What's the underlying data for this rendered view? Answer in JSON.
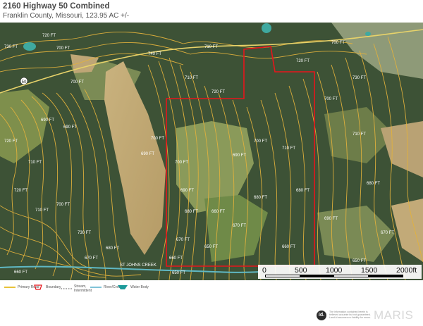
{
  "header": {
    "title": "2160 Highway 50 Combined",
    "subtitle": "Franklin County, Missouri, 123.95 AC +/-"
  },
  "map": {
    "road_marker": "50",
    "contour_labels": [
      "720 FT",
      "700 FT",
      "730 FT",
      "740 FT",
      "710 FT",
      "700 FT",
      "700 FT",
      "690 FT",
      "690 FT",
      "720 FT",
      "710 FT",
      "720 FT",
      "700 FT",
      "710 FT",
      "730 FT",
      "660 FT",
      "670 FT",
      "680 FT",
      "690 FT",
      "700 FT",
      "710 FT",
      "720 FT",
      "700 FT",
      "690 FT",
      "680 FT",
      "670 FT",
      "660 FT",
      "650 FT",
      "650 FT",
      "660 FT",
      "670 FT",
      "680 FT",
      "690 FT",
      "700 FT",
      "710 FT",
      "720 FT",
      "730 FT",
      "700 FT",
      "680 FT",
      "710 FT",
      "690 FT",
      "660 FT",
      "680 FT",
      "670 FT",
      "650 FT"
    ],
    "creek_label": "ST JOHNS CREEK",
    "colors": {
      "contour": "#e3b23c",
      "boundary": "#e8141b",
      "road": "#e8d36a",
      "water": "#3fa9a0"
    }
  },
  "scale": {
    "labels": [
      "0",
      "500",
      "1000",
      "1500",
      "2000ft"
    ]
  },
  "legend": {
    "items": [
      {
        "label": "Primary Road",
        "icon": "road-line"
      },
      {
        "label": "Boundary",
        "icon": "boundary-outline"
      },
      {
        "label": "Stream, Intermittent",
        "icon": "dashed-line"
      },
      {
        "label": "River/Creek",
        "icon": "solid-line"
      },
      {
        "label": "Water Body",
        "icon": "water-shape"
      }
    ],
    "logo_text": "id.",
    "brand": "MARIS",
    "disclaimer": "The information contained herein is believed accurate but not guaranteed. Land.id assumes no liability for errors."
  }
}
